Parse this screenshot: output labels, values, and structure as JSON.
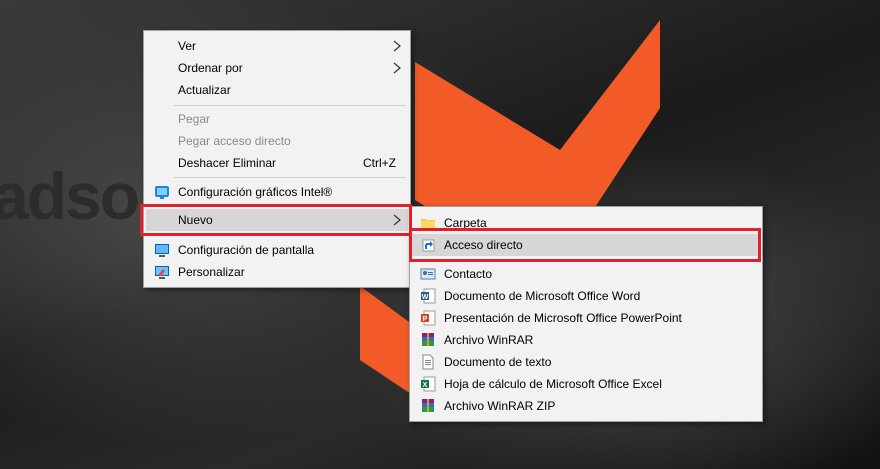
{
  "desktop": {
    "brand_text": "adso",
    "colors": {
      "logo": "#f25a28",
      "highlight_box": "#e0202a"
    }
  },
  "context_menu": {
    "items": [
      {
        "label": "Ver",
        "has_submenu": true
      },
      {
        "label": "Ordenar por",
        "has_submenu": true
      },
      {
        "label": "Actualizar"
      },
      {
        "label": "Pegar",
        "disabled": true
      },
      {
        "label": "Pegar acceso directo",
        "disabled": true
      },
      {
        "label": "Deshacer Eliminar",
        "shortcut": "Ctrl+Z"
      },
      {
        "label": "Configuración gráficos Intel®",
        "icon": "intel-graphics-icon"
      },
      {
        "label": "Nuevo",
        "has_submenu": true,
        "highlighted": true
      },
      {
        "label": "Configuración de pantalla",
        "icon": "display-settings-icon"
      },
      {
        "label": "Personalizar",
        "icon": "personalize-icon"
      }
    ]
  },
  "new_submenu": {
    "items": [
      {
        "label": "Carpeta",
        "icon": "folder-icon"
      },
      {
        "label": "Acceso directo",
        "icon": "shortcut-icon",
        "highlighted": true
      },
      {
        "label": "Contacto",
        "icon": "contact-icon"
      },
      {
        "label": "Documento de Microsoft Office Word",
        "icon": "word-icon"
      },
      {
        "label": "Presentación de Microsoft Office PowerPoint",
        "icon": "powerpoint-icon"
      },
      {
        "label": "Archivo WinRAR",
        "icon": "winrar-icon"
      },
      {
        "label": "Documento de texto",
        "icon": "text-document-icon"
      },
      {
        "label": "Hoja de cálculo de Microsoft Office Excel",
        "icon": "excel-icon"
      },
      {
        "label": "Archivo WinRAR ZIP",
        "icon": "winrar-zip-icon"
      }
    ]
  }
}
